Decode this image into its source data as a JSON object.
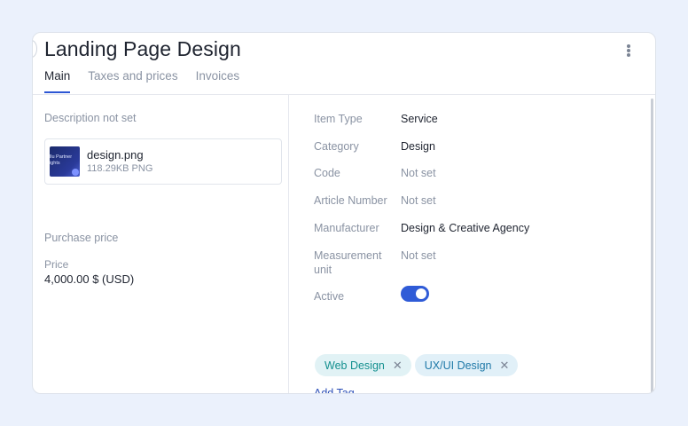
{
  "header": {
    "title": "Landing Page Design"
  },
  "tabs": [
    {
      "label": "Main"
    },
    {
      "label": "Taxes and prices"
    },
    {
      "label": "Invoices"
    }
  ],
  "left": {
    "description": "Description not set",
    "file": {
      "name": "design.png",
      "meta": "118.29KB PNG",
      "thumb_text": "llu Partner\nights"
    },
    "purchase_price_label": "Purchase price",
    "price_label": "Price",
    "price_value": "4,000.00 $ (USD)"
  },
  "details": [
    {
      "label": "Item Type",
      "value": "Service"
    },
    {
      "label": "Category",
      "value": "Design"
    },
    {
      "label": "Code",
      "value": "Not set"
    },
    {
      "label": "Article Number",
      "value": "Not set"
    },
    {
      "label": "Manufacturer",
      "value": "Design & Creative Agency"
    },
    {
      "label": "Measurement unit",
      "value": "Not set"
    },
    {
      "label": "Active",
      "value": ""
    }
  ],
  "active": true,
  "tags": [
    {
      "label": "Web Design"
    },
    {
      "label": "UX/UI Design"
    }
  ],
  "add_tag_label": "Add Tag",
  "icons": {
    "more": "more-vertical-icon",
    "remove": "close-icon"
  },
  "colors": {
    "accent": "#2f5bd7",
    "background": "#ebf1fc",
    "tag_teal": "#14908f",
    "tag_blue": "#1f79a8"
  }
}
